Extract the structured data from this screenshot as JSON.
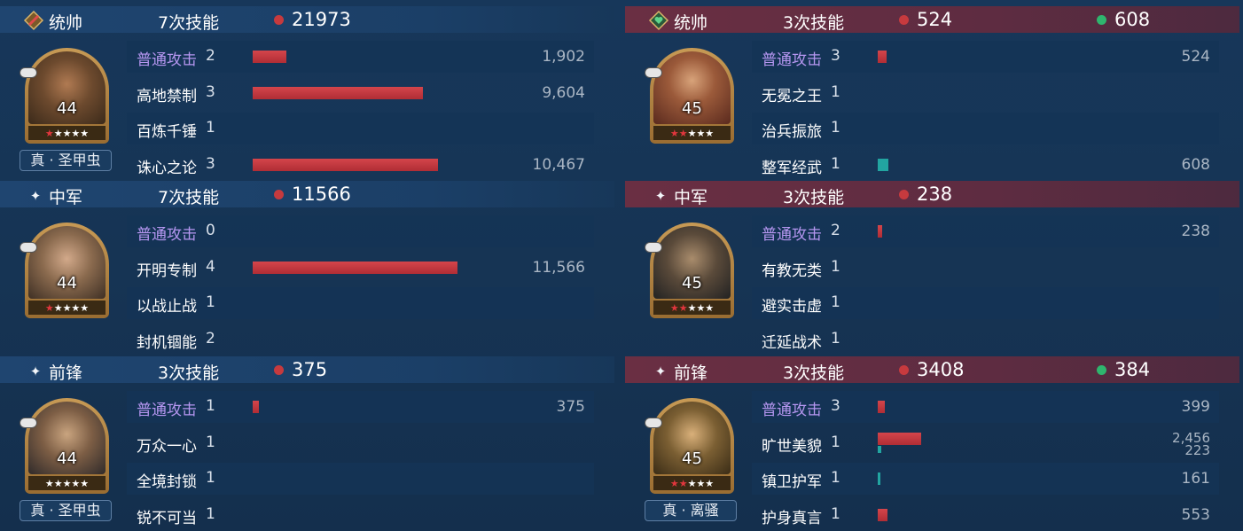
{
  "colors": {
    "damage": "#c63a3e",
    "heal": "#2fb56e"
  },
  "left": {
    "sections": [
      {
        "position": "统帅",
        "position_icon": "sword-banner-icon",
        "skills": "7次技能",
        "damage": "21973",
        "level": "44",
        "stars": 5,
        "red_stars": 1,
        "badge": "真 · 圣甲虫",
        "rows": [
          {
            "name": "普通攻击",
            "count": "2",
            "value": "1,902",
            "bar": 0.0727
          },
          {
            "name": "高地禁制",
            "count": "3",
            "value": "9,604",
            "bar": 0.367
          },
          {
            "name": "百炼千锤",
            "count": "1",
            "value": "",
            "bar": 0
          },
          {
            "name": "诛心之论",
            "count": "3",
            "value": "10,467",
            "bar": 0.4
          }
        ]
      },
      {
        "position": "中军",
        "position_icon": "spark-icon",
        "skills": "7次技能",
        "damage": "11566",
        "level": "44",
        "stars": 5,
        "red_stars": 1,
        "badge": "",
        "rows": [
          {
            "name": "普通攻击",
            "count": "0",
            "value": "",
            "bar": 0
          },
          {
            "name": "开明专制",
            "count": "4",
            "value": "11,566",
            "bar": 0.442
          },
          {
            "name": "以战止战",
            "count": "1",
            "value": "",
            "bar": 0
          },
          {
            "name": "封机锢能",
            "count": "2",
            "value": "",
            "bar": 0
          }
        ]
      },
      {
        "position": "前锋",
        "position_icon": "spark-icon",
        "skills": "3次技能",
        "damage": "375",
        "level": "44",
        "stars": 5,
        "red_stars": 0,
        "badge": "真 · 圣甲虫",
        "rows": [
          {
            "name": "普通攻击",
            "count": "1",
            "value": "375",
            "bar": 0.0143
          },
          {
            "name": "万众一心",
            "count": "1",
            "value": "",
            "bar": 0
          },
          {
            "name": "全境封锁",
            "count": "1",
            "value": "",
            "bar": 0
          },
          {
            "name": "锐不可当",
            "count": "1",
            "value": "",
            "bar": 0
          }
        ]
      }
    ]
  },
  "right": {
    "sections": [
      {
        "position": "统帅",
        "position_icon": "heart-shield-icon",
        "skills": "3次技能",
        "damage": "524",
        "heal": "608",
        "level": "45",
        "stars": 5,
        "red_stars": 2,
        "badge": "",
        "rows": [
          {
            "name": "普通攻击",
            "count": "3",
            "value": "524",
            "bar": 0.02
          },
          {
            "name": "无冕之王",
            "count": "1",
            "value": "",
            "bar": 0
          },
          {
            "name": "治兵振旅",
            "count": "1",
            "value": "",
            "bar": 0
          },
          {
            "name": "整军经武",
            "count": "1",
            "value": "608",
            "bar": 0.0232,
            "teal": true
          }
        ]
      },
      {
        "position": "中军",
        "position_icon": "spark-icon",
        "skills": "3次技能",
        "damage": "238",
        "level": "45",
        "stars": 5,
        "red_stars": 2,
        "badge": "",
        "rows": [
          {
            "name": "普通攻击",
            "count": "2",
            "value": "238",
            "bar": 0.0091
          },
          {
            "name": "有教无类",
            "count": "1",
            "value": "",
            "bar": 0
          },
          {
            "name": "避实击虚",
            "count": "1",
            "value": "",
            "bar": 0
          },
          {
            "name": "迁延战术",
            "count": "1",
            "value": "",
            "bar": 0
          }
        ]
      },
      {
        "position": "前锋",
        "position_icon": "spark-icon",
        "skills": "3次技能",
        "damage": "3408",
        "heal": "384",
        "level": "45",
        "stars": 5,
        "red_stars": 2,
        "badge": "真 · 离骚",
        "rows": [
          {
            "name": "普通攻击",
            "count": "3",
            "value": "399",
            "bar": 0.0152
          },
          {
            "name": "旷世美貌",
            "count": "1",
            "value": "2,456",
            "value2": "223",
            "bar": 0.0938,
            "bar2": 0.0085
          },
          {
            "name": "镇卫护军",
            "count": "1",
            "value": "161",
            "bar": 0.0061,
            "teal": true
          },
          {
            "name": "护身真言",
            "count": "1",
            "value": "553",
            "bar": 0.0211
          }
        ]
      }
    ]
  }
}
